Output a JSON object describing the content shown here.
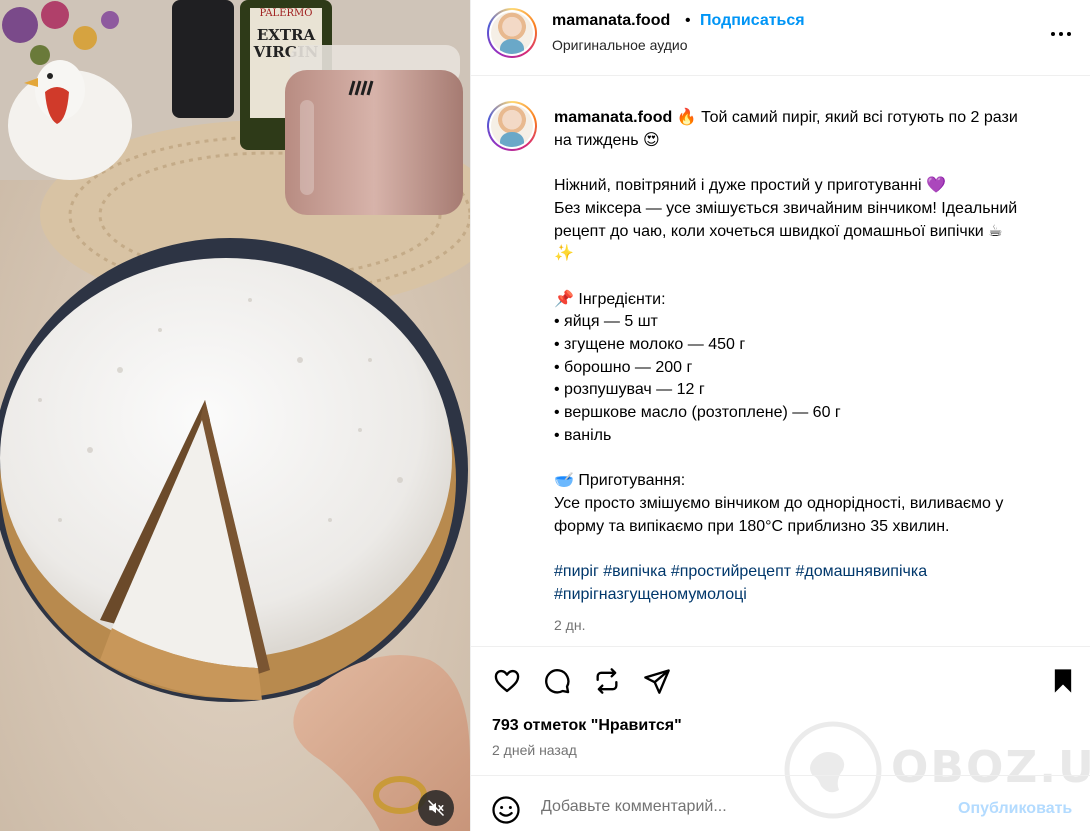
{
  "header": {
    "username": "mamanata.food",
    "separator": "•",
    "follow_label": "Подписаться",
    "audio_label": "Оригинальное аудио",
    "more_icon": "more-horizontal-icon"
  },
  "caption": {
    "username": "mamanata.food",
    "line1": "🔥 Той самий пиріг, який всі готують по 2 рази",
    "line2": "на тиждень 😍",
    "line3": "Ніжний, повітряний і дуже простий у приготуванні 💜",
    "line4": "Без міксера — усе змішується звичайним вінчиком! Ідеальний",
    "line5": "рецепт до чаю, коли хочеться швидкої домашньої випічки ☕",
    "line6": "✨",
    "ingredients_title": "📌 Інгредієнти:",
    "ingredients": [
      "• яйця — 5 шт",
      "• згущене молоко — 450 г",
      "• борошно — 200 г",
      "• розпушувач — 12 г",
      "• вершкове масло (розтоплене) — 60 г",
      "• ваніль"
    ],
    "prep_title": "🥣 Приготування:",
    "prep_line1": "Усе просто змішуємо вінчиком до однорідності, виливаємо у",
    "prep_line2": "форму та випікаємо при 180°C приблизно 35 хвилин.",
    "hashtags_line1": "#пиріг #випічка #простийрецепт #домашнявипічка",
    "hashtags_line2": "#пирігназгущеномумолоці",
    "time": "2 дн."
  },
  "actions": {
    "like_icon": "heart-icon",
    "comment_icon": "comment-icon",
    "repost_icon": "repost-icon",
    "share_icon": "send-icon",
    "save_icon": "bookmark-icon"
  },
  "likes_text": "793 отметок \"Нравится\"",
  "date_text": "2 дней назад",
  "comment": {
    "emoji_icon": "smiley-icon",
    "placeholder": "Добавьте комментарий...",
    "value": "",
    "publish_label": "Опубликовать"
  },
  "media": {
    "mute_icon": "speaker-muted-icon",
    "bottle_label_line1": "EXTRA",
    "bottle_label_line2": "VIRGIN",
    "bottle_brand": "PALERMO"
  },
  "watermark": {
    "text": "OBOZ.UA"
  },
  "colors": {
    "link_blue": "#0095f6",
    "hashtag_blue": "#00376b",
    "muted_text": "#737373",
    "publish_disabled": "#b3dbff"
  }
}
